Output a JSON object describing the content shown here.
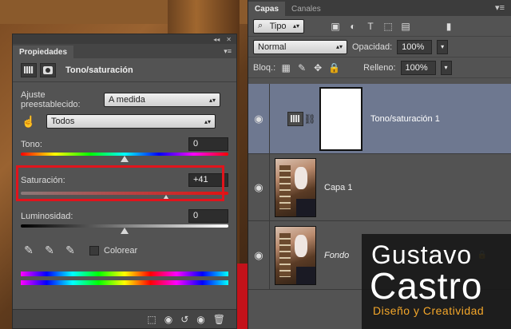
{
  "properties": {
    "panel_tab": "Propiedades",
    "adjustment_title": "Tono/saturación",
    "preset_label": "Ajuste preestablecido:",
    "preset_value": "A medida",
    "channel_value": "Todos",
    "hue_label": "Tono:",
    "hue_value": "0",
    "hue_level": 0.5,
    "saturation_label": "Saturación:",
    "saturation_value": "+41",
    "saturation_level": 0.7,
    "lightness_label": "Luminosidad:",
    "lightness_value": "0",
    "lightness_level": 0.5,
    "colorize_label": "Colorear"
  },
  "layers_panel": {
    "tabs": [
      "Capas",
      "Canales"
    ],
    "filter_value": "Tipo",
    "blend_mode": "Normal",
    "opacity_label": "Opacidad:",
    "opacity_value": "100%",
    "lock_label": "Bloq.:",
    "fill_label": "Relleno:",
    "fill_value": "100%",
    "layers": [
      {
        "name": "Tono/saturación 1"
      },
      {
        "name": "Capa 1"
      },
      {
        "name": "Fondo"
      }
    ]
  },
  "watermark": {
    "line1": "Gustavo",
    "line2": "Castro",
    "line3": "Diseño y Creatividad",
    "accent": "#f4a72a"
  },
  "colors": {
    "selection_box": "#e1141c",
    "selected_layer": "#6e7890"
  }
}
